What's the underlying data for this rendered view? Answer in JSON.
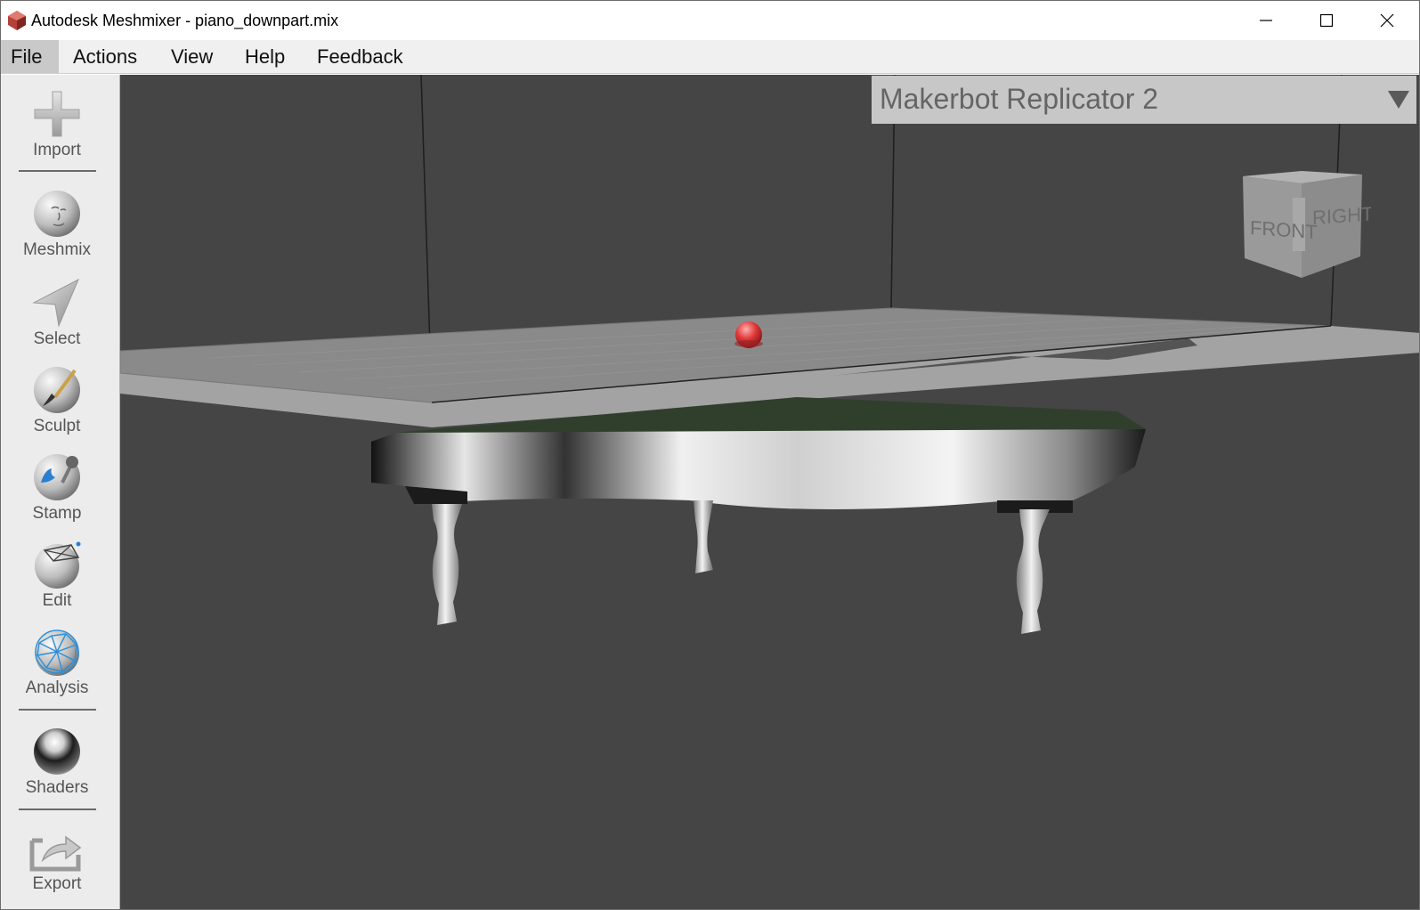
{
  "window": {
    "title": "Autodesk Meshmixer - piano_downpart.mix",
    "controls": [
      "minimize-icon",
      "maximize-icon",
      "close-icon"
    ]
  },
  "menu": {
    "items": [
      {
        "label": "File",
        "active": true
      },
      {
        "label": "Actions"
      },
      {
        "label": "View"
      },
      {
        "label": "Help"
      },
      {
        "label": "Feedback"
      }
    ]
  },
  "toolbar": {
    "items": [
      {
        "label": "Import",
        "icon": "plus-icon"
      },
      {
        "label": "Meshmix",
        "icon": "face-sphere-icon"
      },
      {
        "label": "Select",
        "icon": "arrow-cursor-icon"
      },
      {
        "label": "Sculpt",
        "icon": "brush-sphere-icon"
      },
      {
        "label": "Stamp",
        "icon": "stamp-sphere-icon"
      },
      {
        "label": "Edit",
        "icon": "edit-sphere-icon"
      },
      {
        "label": "Analysis",
        "icon": "mesh-sphere-icon"
      },
      {
        "label": "Shaders",
        "icon": "chrome-sphere-icon"
      },
      {
        "label": "Export",
        "icon": "export-icon"
      }
    ]
  },
  "viewport": {
    "printer_selector": "Makerbot Replicator 2",
    "viewcube": {
      "front": "FRONT",
      "right": "RIGHT"
    },
    "colors": {
      "background": "#454545",
      "platform": "#8a8a8a",
      "model_top": "#2f3f2c",
      "pivot": "#e23b3b"
    }
  }
}
